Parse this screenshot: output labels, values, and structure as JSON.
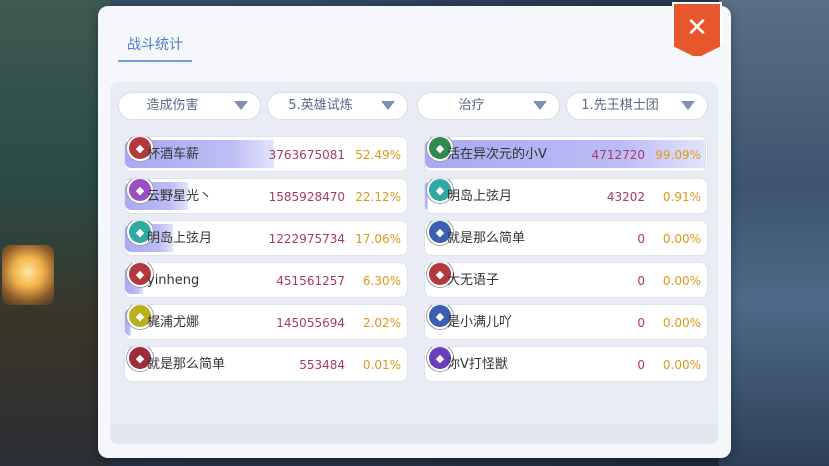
{
  "title_tab": "战斗统计",
  "close_glyph": "✕",
  "left_panel": {
    "stat_dropdown": "造成伤害",
    "dungeon_dropdown": "5.英雄试炼",
    "rows": [
      {
        "name": "杯酒车薪",
        "value": "3763675081",
        "percent": "52.49%",
        "bar_fraction": 0.5249,
        "badge_color": "#b2383e"
      },
      {
        "name": "云野星光丶",
        "value": "1585928470",
        "percent": "22.12%",
        "bar_fraction": 0.2212,
        "badge_color": "#9a4fc0"
      },
      {
        "name": "明岛上弦月",
        "value": "1222975734",
        "percent": "17.06%",
        "bar_fraction": 0.1706,
        "badge_color": "#2fa9a4"
      },
      {
        "name": "yinheng",
        "value": "451561257",
        "percent": "6.30%",
        "bar_fraction": 0.063,
        "badge_color": "#b2383e"
      },
      {
        "name": "梶浦尤娜",
        "value": "145055694",
        "percent": "2.02%",
        "bar_fraction": 0.0202,
        "badge_color": "#b8b21e"
      },
      {
        "name": "就是那么简单",
        "value": "553484",
        "percent": "0.01%",
        "bar_fraction": 0.0001,
        "badge_color": "#a02c3a"
      }
    ]
  },
  "right_panel": {
    "stat_dropdown": "治疗",
    "dungeon_dropdown": "1.先王棋士团",
    "rows": [
      {
        "name": "活在异次元的小V",
        "value": "4712720",
        "percent": "99.09%",
        "bar_fraction": 0.9909,
        "badge_color": "#2f8a52"
      },
      {
        "name": "明岛上弦月",
        "value": "43202",
        "percent": "0.91%",
        "bar_fraction": 0.0091,
        "badge_color": "#2fa9a4"
      },
      {
        "name": "就是那么简单",
        "value": "0",
        "percent": "0.00%",
        "bar_fraction": 0,
        "badge_color": "#3b5fb0"
      },
      {
        "name": "大无语子",
        "value": "0",
        "percent": "0.00%",
        "bar_fraction": 0,
        "badge_color": "#b2383e"
      },
      {
        "name": "是小满儿吖",
        "value": "0",
        "percent": "0.00%",
        "bar_fraction": 0,
        "badge_color": "#3b5fb0"
      },
      {
        "name": "沵V打怪獣",
        "value": "0",
        "percent": "0.00%",
        "bar_fraction": 0,
        "badge_color": "#6a3fb8"
      }
    ]
  }
}
